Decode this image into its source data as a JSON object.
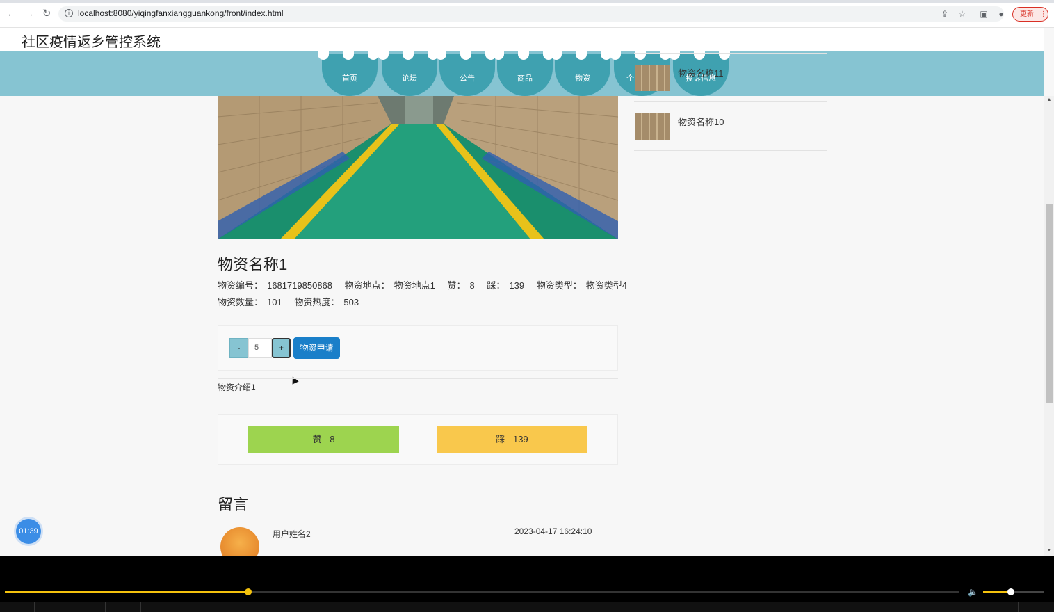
{
  "browser": {
    "url": "localhost:8080/yiqingfanxiangguankong/front/index.html",
    "update_label": "更新"
  },
  "site": {
    "title": "社区疫情返乡管控系统",
    "nav": [
      "首页",
      "论坛",
      "公告",
      "商品",
      "物资",
      "个人中心",
      "投诉信息"
    ]
  },
  "sidebar": {
    "items": [
      {
        "label": "物资名称11"
      },
      {
        "label": "物资名称10"
      }
    ]
  },
  "item": {
    "title": "物资名称1",
    "code_label": "物资编号：",
    "code": "1681719850868",
    "location_label": "物资地点：",
    "location": "物资地点1",
    "like_label": "赞：",
    "like": "8",
    "dislike_label": "踩：",
    "dislike": "139",
    "type_label": "物资类型：",
    "type": "物资类型4",
    "quantity_label": "物资数量：",
    "quantity": "101",
    "heat_label": "物资热度：",
    "heat": "503",
    "intro": "物资介绍1"
  },
  "purchase": {
    "minus": "-",
    "qty": "5",
    "plus": "+",
    "apply_label": "物资申请"
  },
  "vote": {
    "like_label": "赞",
    "like_count": "8",
    "dislike_label": "踩",
    "dislike_count": "139"
  },
  "comments": {
    "title": "留言",
    "list": [
      {
        "user": "用户姓名2",
        "time": "2023-04-17 16:24:10"
      }
    ]
  },
  "overlay": {
    "timer": "01:39"
  },
  "player": {
    "progress": 0.255,
    "volume": 0.45
  }
}
